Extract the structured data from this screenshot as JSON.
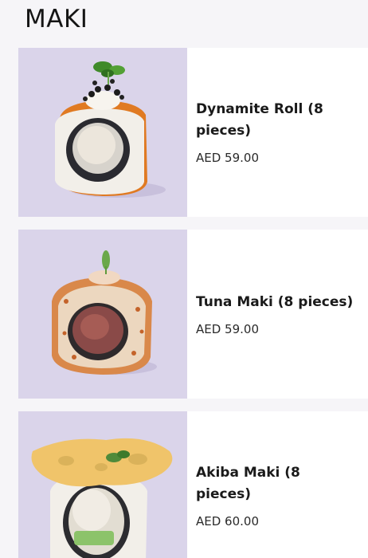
{
  "section": {
    "title": "MAKI"
  },
  "items": [
    {
      "name": "Dynamite Roll (8 pieces)",
      "price": "AED 59.00",
      "image": "dynamite-roll-photo"
    },
    {
      "name": "Tuna Maki (8 pieces)",
      "price": "AED 59.00",
      "image": "tuna-maki-photo"
    },
    {
      "name": "Akiba Maki (8 pieces)",
      "price": "AED 60.00",
      "image": "akiba-maki-photo"
    }
  ],
  "colors": {
    "page_background": "#f6f5f8",
    "card_background": "#ffffff",
    "photo_background": "#dad4ea"
  }
}
